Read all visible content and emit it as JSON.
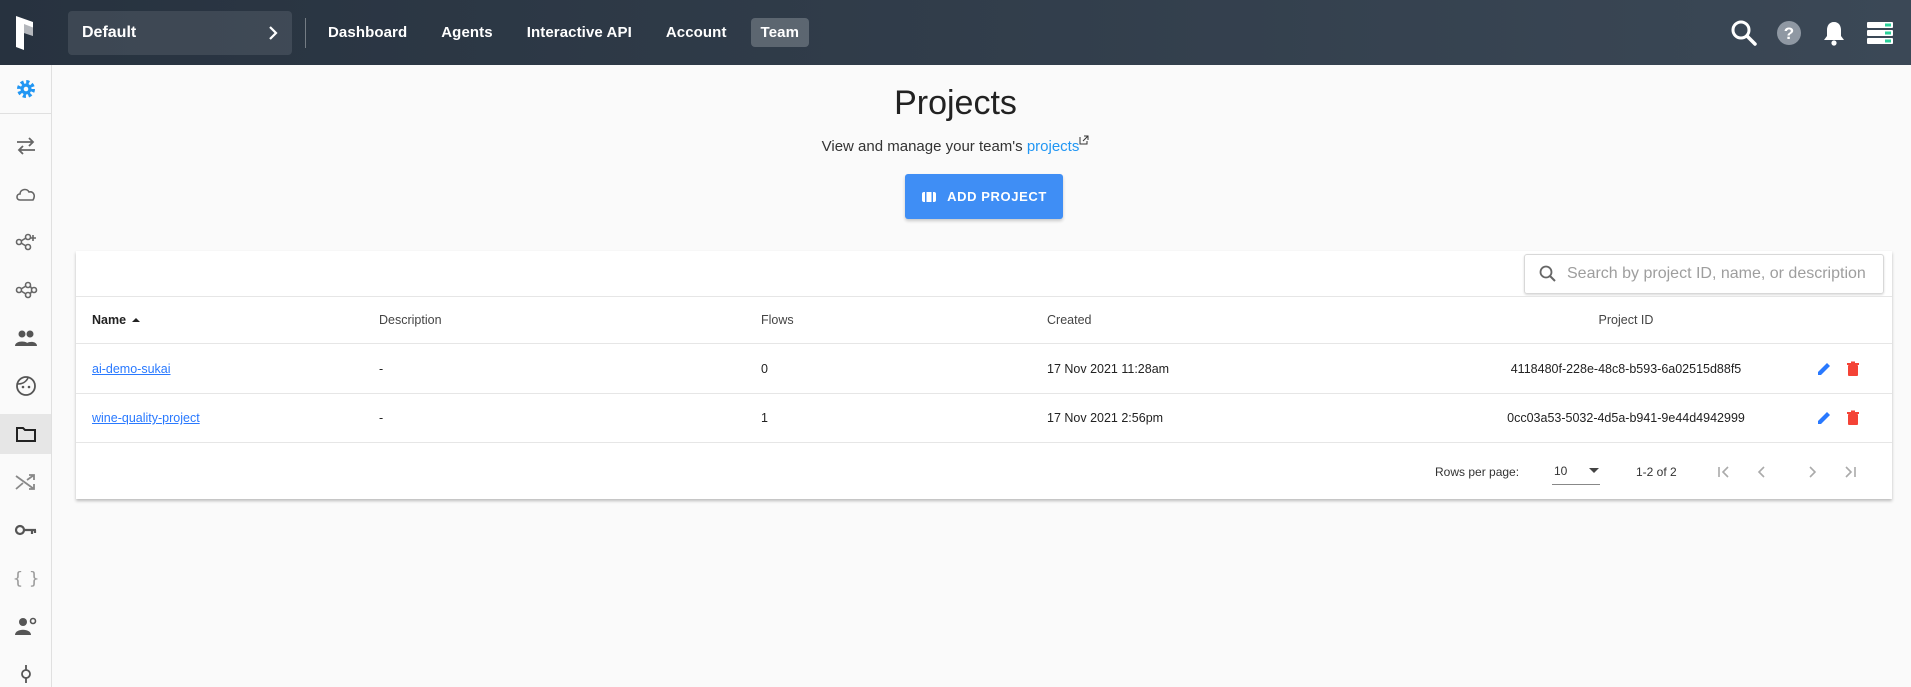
{
  "topbar": {
    "workspace": "Default",
    "tabs": [
      "Dashboard",
      "Agents",
      "Interactive API",
      "Account",
      "Team"
    ],
    "active_tab": "Team",
    "status_color": "#2ad19a"
  },
  "sidebar": {
    "active_item": "projects",
    "accent_color": "#2196f3",
    "items": [
      "settings",
      "flows",
      "cloud",
      "tasks",
      "flow-runs",
      "team",
      "profile",
      "projects",
      "automations",
      "api-keys",
      "secrets",
      "members",
      "webhooks"
    ]
  },
  "page": {
    "title": "Projects",
    "subtitle_prefix": "View and manage your team's ",
    "subtitle_link": "projects",
    "add_button": "ADD PROJECT"
  },
  "search": {
    "placeholder": "Search by project ID, name, or description"
  },
  "table": {
    "columns": [
      "Name",
      "Description",
      "Flows",
      "Created",
      "Project ID"
    ],
    "sort_column": "Name",
    "rows": [
      {
        "name": "ai-demo-sukai",
        "description": "-",
        "flows": "0",
        "created": "17 Nov 2021 11:28am",
        "project_id": "4118480f-228e-48c8-b593-6a02515d88f5"
      },
      {
        "name": "wine-quality-project",
        "description": "-",
        "flows": "1",
        "created": "17 Nov 2021 2:56pm",
        "project_id": "0cc03a53-5032-4d5a-b941-9e44d4942999"
      }
    ],
    "pagination": {
      "rows_per_page_label": "Rows per page:",
      "rows_per_page": "10",
      "range": "1-2 of 2"
    }
  }
}
